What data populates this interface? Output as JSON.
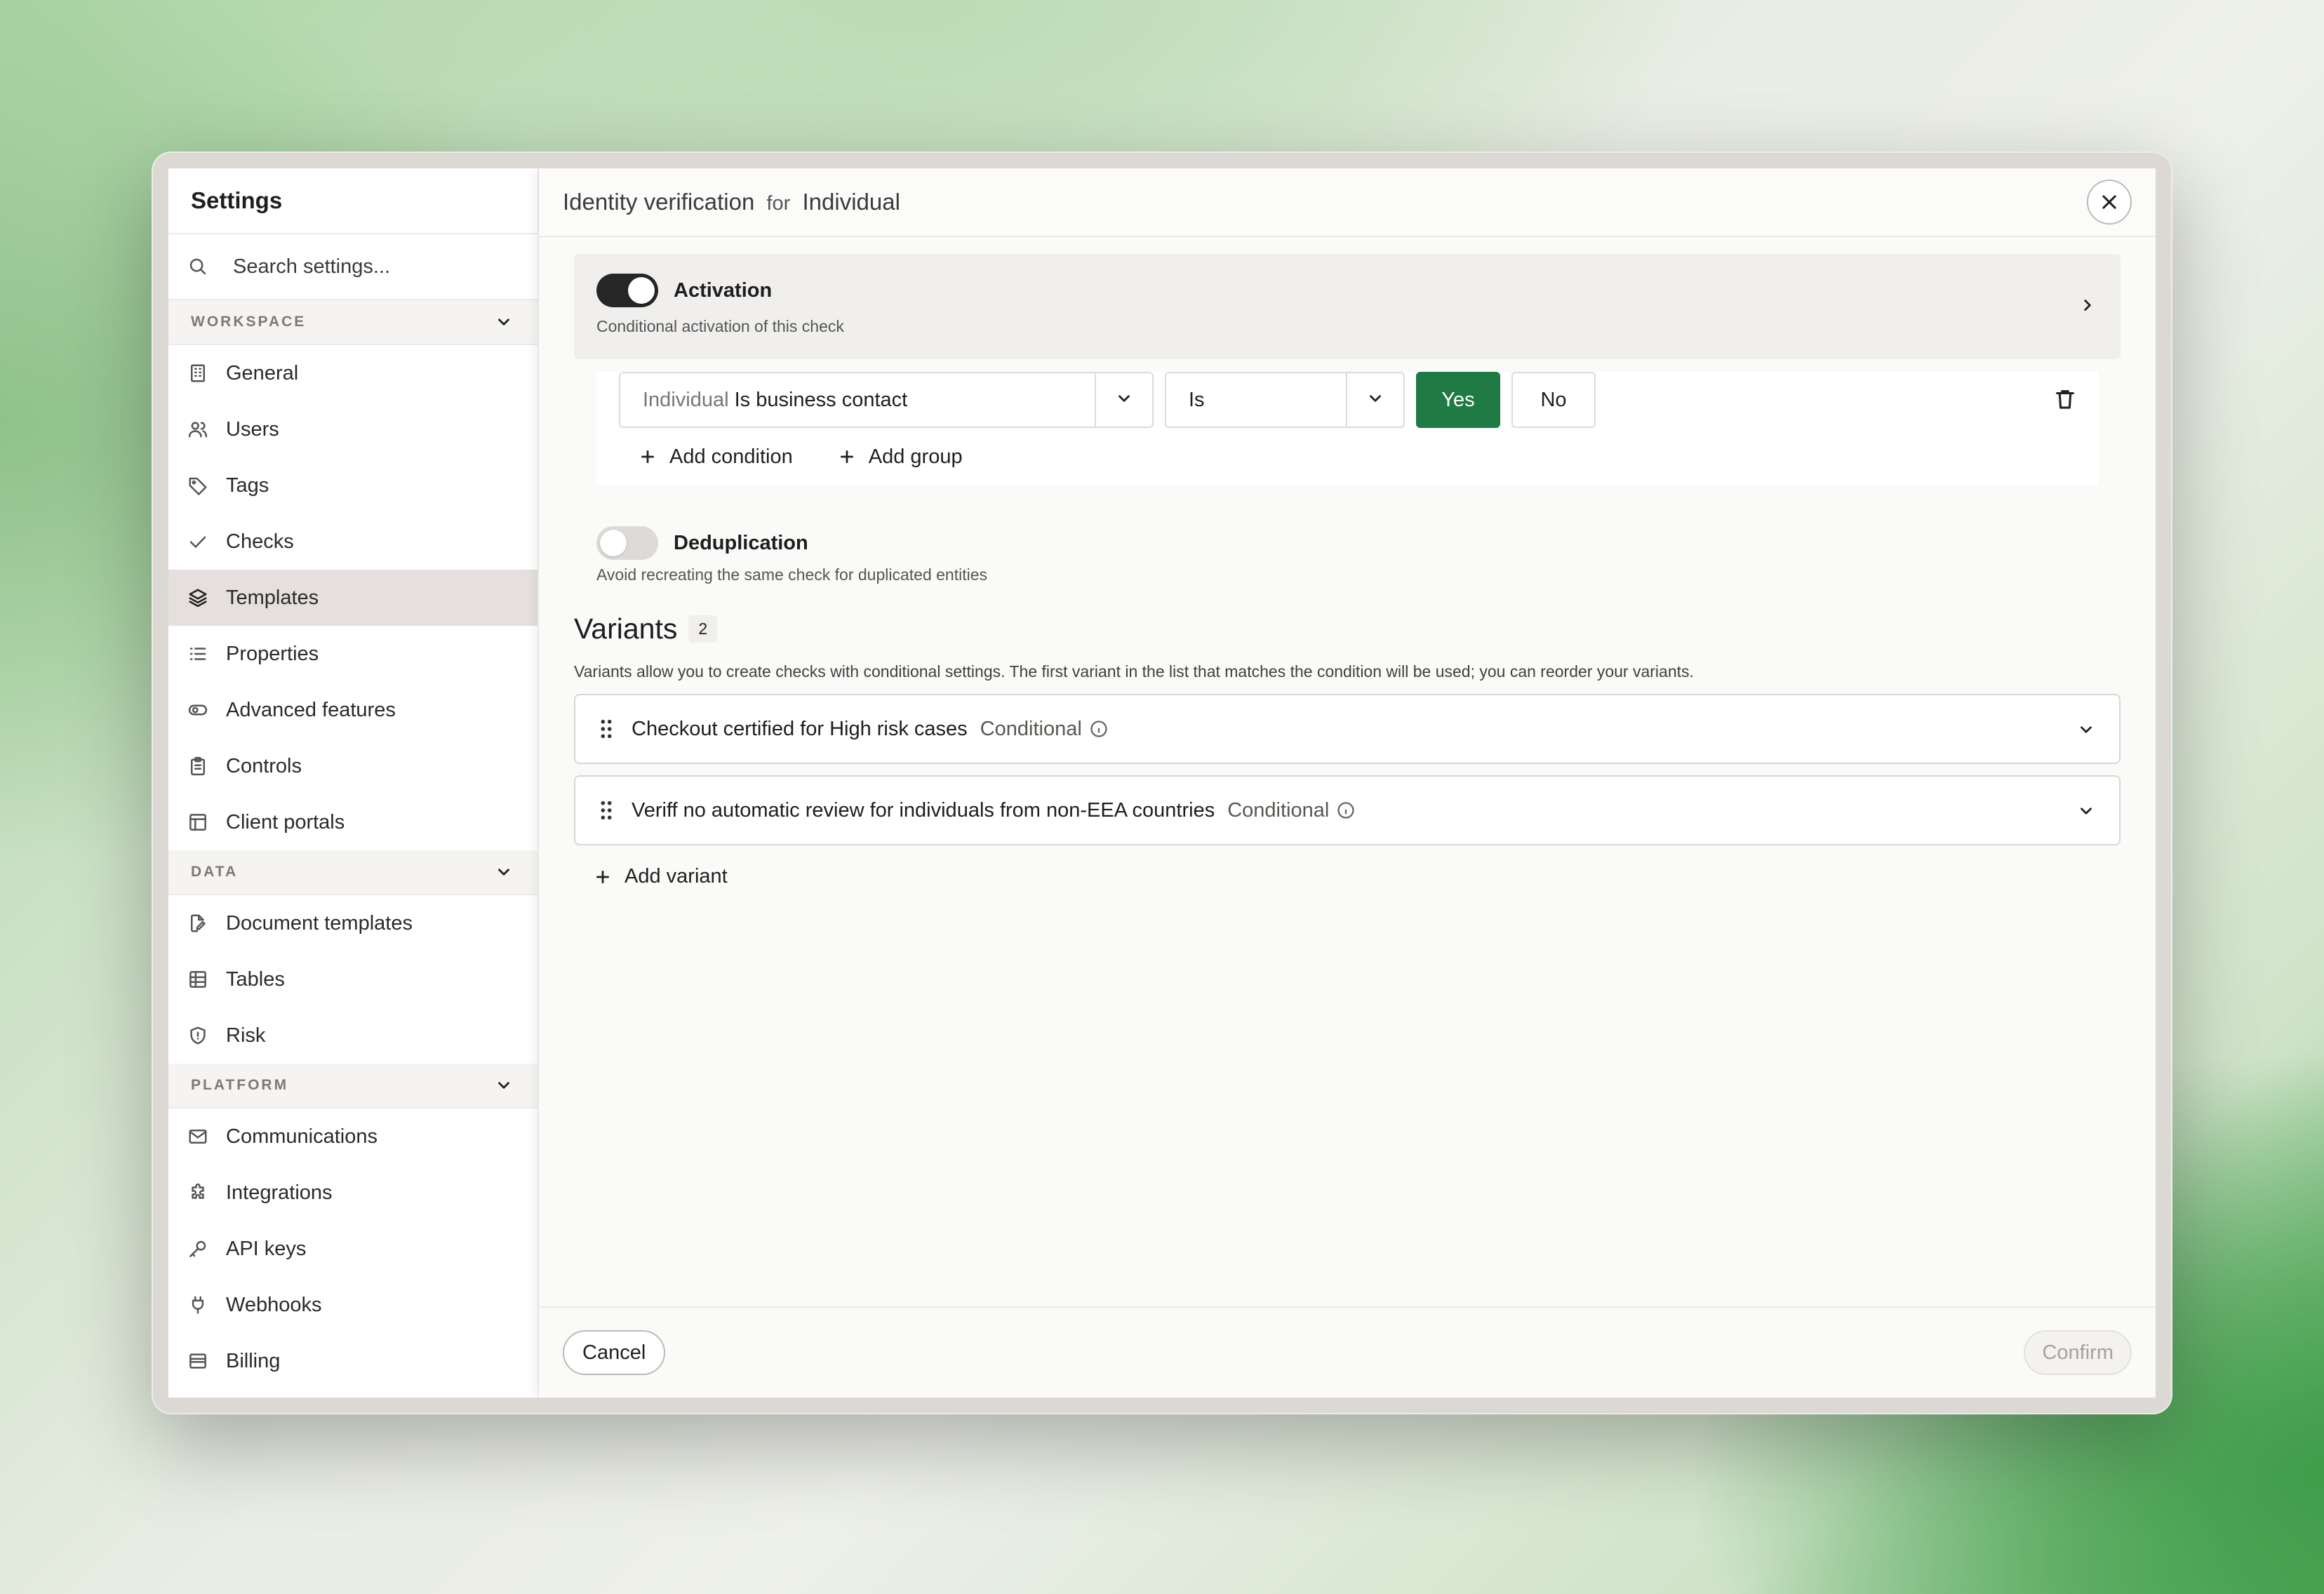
{
  "sidebar": {
    "title": "Settings",
    "search_placeholder": "Search settings...",
    "sections": [
      {
        "label": "WORKSPACE",
        "items": [
          {
            "label": "General",
            "icon": "building-icon"
          },
          {
            "label": "Users",
            "icon": "users-icon"
          },
          {
            "label": "Tags",
            "icon": "tag-icon"
          },
          {
            "label": "Checks",
            "icon": "check-icon"
          },
          {
            "label": "Templates",
            "icon": "layers-icon",
            "active": true
          },
          {
            "label": "Properties",
            "icon": "list-icon"
          },
          {
            "label": "Advanced features",
            "icon": "toggle-icon"
          },
          {
            "label": "Controls",
            "icon": "clipboard-icon"
          },
          {
            "label": "Client portals",
            "icon": "layout-icon"
          }
        ]
      },
      {
        "label": "DATA",
        "items": [
          {
            "label": "Document templates",
            "icon": "file-edit-icon"
          },
          {
            "label": "Tables",
            "icon": "table-icon"
          },
          {
            "label": "Risk",
            "icon": "shield-icon"
          }
        ]
      },
      {
        "label": "PLATFORM",
        "items": [
          {
            "label": "Communications",
            "icon": "mail-icon"
          },
          {
            "label": "Integrations",
            "icon": "puzzle-icon"
          },
          {
            "label": "API keys",
            "icon": "key-icon"
          },
          {
            "label": "Webhooks",
            "icon": "plug-icon"
          },
          {
            "label": "Billing",
            "icon": "wallet-icon"
          }
        ]
      }
    ]
  },
  "modal": {
    "title_main": "Identity verification",
    "title_for": "for",
    "title_entity": "Individual",
    "activation": {
      "title": "Activation",
      "description": "Conditional activation of this check",
      "enabled": true
    },
    "condition": {
      "field_prefix": "Individual",
      "field_name": "Is business contact",
      "operator": "Is",
      "yes_label": "Yes",
      "no_label": "No",
      "selected": "Yes",
      "add_condition": "Add condition",
      "add_group": "Add group"
    },
    "deduplication": {
      "title": "Deduplication",
      "description": "Avoid recreating the same check for duplicated entities",
      "enabled": false
    },
    "variants": {
      "heading": "Variants",
      "count": "2",
      "description": "Variants allow you to create checks with conditional settings. The first variant in the list that matches the condition will be used; you can reorder your variants.",
      "items": [
        {
          "name": "Checkout certified for High risk cases",
          "tag": "Conditional"
        },
        {
          "name": "Veriff no automatic review for individuals from non-EEA countries",
          "tag": "Conditional"
        }
      ],
      "add_label": "Add variant"
    },
    "footer": {
      "cancel": "Cancel",
      "confirm": "Confirm"
    }
  },
  "colors": {
    "accent_green": "#1f7a44",
    "toggle_on": "#262626",
    "active_item_bg": "#e5e0dd"
  }
}
